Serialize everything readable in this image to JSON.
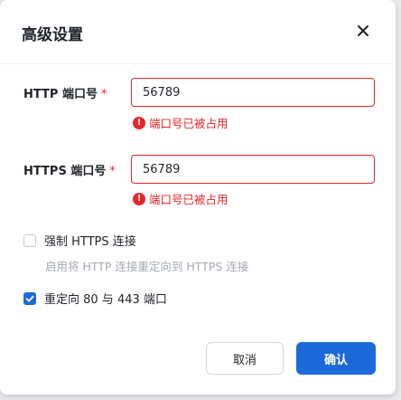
{
  "dialog": {
    "title": "高级设置",
    "close_icon": "close-icon"
  },
  "http_port": {
    "label": "HTTP 端口号",
    "required_mark": "*",
    "value": "56789",
    "error": "端口号已被占用"
  },
  "https_port": {
    "label": "HTTPS 端口号",
    "required_mark": "*",
    "value": "56789",
    "error": "端口号已被占用"
  },
  "force_https": {
    "checked": false,
    "label": "强制 HTTPS 连接",
    "hint": "启用将 HTTP 连接重定向到 HTTPS 连接"
  },
  "redirect_80_443": {
    "checked": true,
    "label": "重定向 80 与 443 端口",
    "hint": ""
  },
  "footer": {
    "cancel_label": "取消",
    "ok_label": "确认"
  },
  "colors": {
    "accent": "#1c6ad9",
    "error": "#e5262a"
  }
}
